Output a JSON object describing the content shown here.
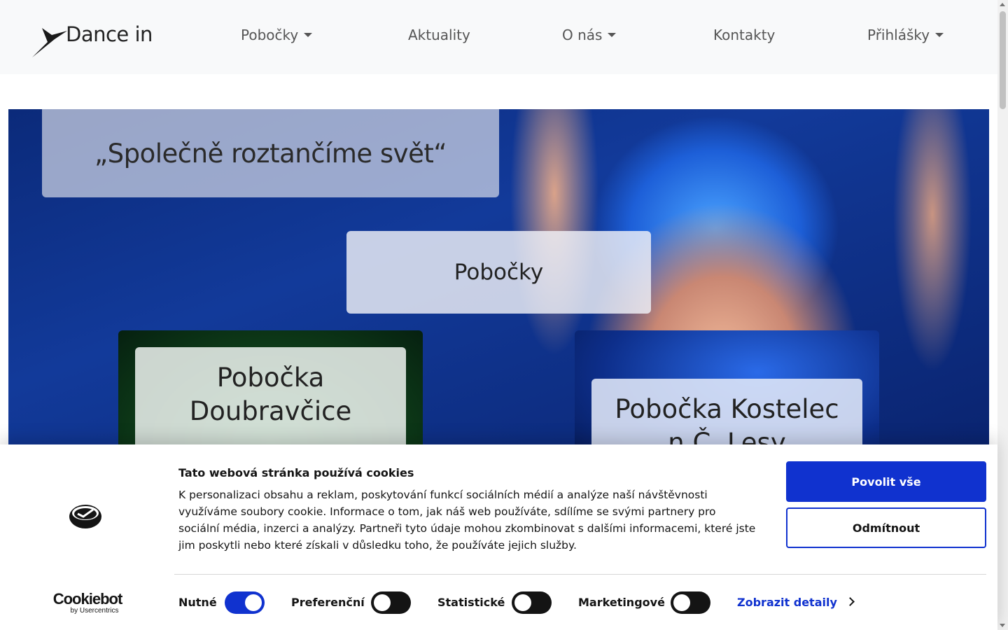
{
  "navbar": {
    "logo_text": "Dance in",
    "items": [
      {
        "label": "Pobočky",
        "dropdown": true
      },
      {
        "label": "Aktuality",
        "dropdown": false
      },
      {
        "label": "O nás",
        "dropdown": true
      },
      {
        "label": "Kontakty",
        "dropdown": false
      },
      {
        "label": "Přihlášky",
        "dropdown": true
      }
    ]
  },
  "hero": {
    "quote": "„Společně roztančíme svět“",
    "section_title": "Pobočky",
    "cards": [
      {
        "title": "Pobočka Doubravčice"
      },
      {
        "title": "Pobočka Kostelec n.Č. Lesy"
      }
    ]
  },
  "cookie_banner": {
    "title": "Tato webová stránka používá cookies",
    "body": "K personalizaci obsahu a reklam, poskytování funkcí sociálních médií a analýze naší návštěvnosti využíváme soubory cookie. Informace o tom, jak náš web používáte, sdílíme se svými partnery pro sociální média, inzerci a analýzy. Partneři tyto údaje mohou zkombinovat s dalšími informacemi, které jste jim poskytli nebo které získali v důsledku toho, že používáte jejich služby.",
    "accept_label": "Povolit vše",
    "reject_label": "Odmítnout",
    "brand_name": "Cookiebot",
    "brand_sub": "by Usercentrics",
    "toggles": [
      {
        "label": "Nutné",
        "on": true
      },
      {
        "label": "Preferenční",
        "on": false
      },
      {
        "label": "Statistické",
        "on": false
      },
      {
        "label": "Marketingové",
        "on": false
      }
    ],
    "details_label": "Zobrazit detaily"
  },
  "colors": {
    "accent": "#1032cf",
    "navbar_bg": "#f8f9fa",
    "hero_blue": "#0b2a7a"
  }
}
